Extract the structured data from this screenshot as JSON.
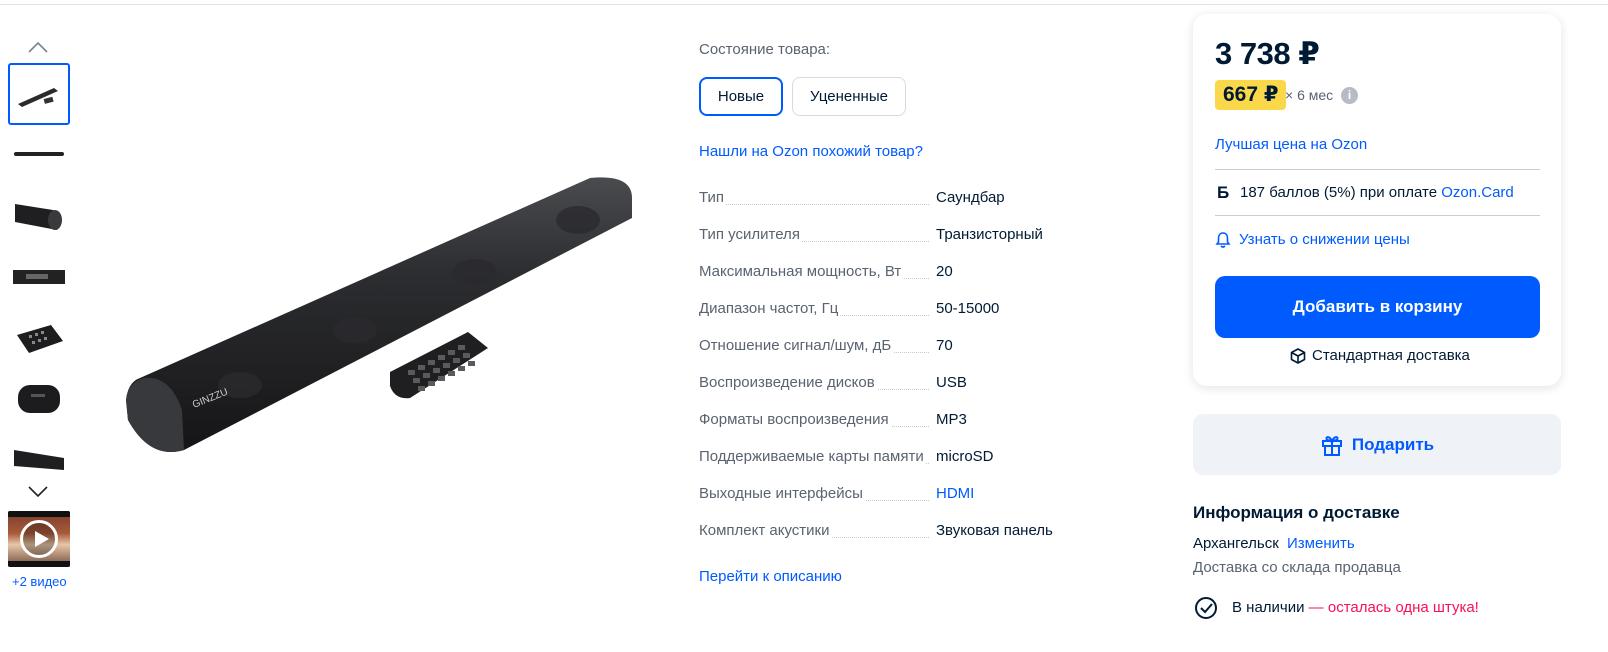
{
  "gallery": {
    "thumbnails": [
      "soundbar-with-remote",
      "soundbar-side",
      "soundbar-end",
      "soundbar-panel",
      "remote-control",
      "soundbar-end-cap",
      "soundbar-angle"
    ],
    "video_label": "+2 видео"
  },
  "condition": {
    "label": "Состояние товара:",
    "options": [
      "Новые",
      "Уцененные"
    ],
    "selected": "Новые"
  },
  "similar_link": "Нашли на Ozon похожий товар?",
  "specs": [
    {
      "name": "Тип",
      "value": "Саундбар"
    },
    {
      "name": "Тип усилителя",
      "value": "Транзисторный"
    },
    {
      "name": "Максимальная мощность, Вт",
      "value": "20"
    },
    {
      "name": "Диапазон частот, Гц",
      "value": "50-15000"
    },
    {
      "name": "Отношение сигнал/шум, дБ",
      "value": "70"
    },
    {
      "name": "Воспроизведение дисков",
      "value": "USB"
    },
    {
      "name": "Форматы воспроизведения",
      "value": "MP3"
    },
    {
      "name": "Поддерживаемые карты памяти",
      "value": "microSD"
    },
    {
      "name": "Выходные интерфейсы",
      "value": "HDMI"
    },
    {
      "name": "Комплект акустики",
      "value": "Звуковая панель"
    }
  ],
  "description_link": "Перейти к описанию",
  "price_card": {
    "price": "3 738 ₽",
    "installment": "667 ₽",
    "months": "× 6 мес",
    "best_price": "Лучшая цена на Ozon",
    "bonus_letter": "Б",
    "bonus_text": "187 баллов (5%) при оплате ",
    "bonus_link": "Ozon.Card",
    "price_alert": "Узнать о снижении цены",
    "add_to_cart": "Добавить в корзину",
    "delivery_type": "Стандартная доставка"
  },
  "gift_button": "Подарить",
  "delivery": {
    "title": "Информация о доставке",
    "city": "Архангельск",
    "change": "Изменить",
    "source": "Доставка со склада продавца",
    "stock": "В наличии",
    "stock_warning": " — осталась одна штука!"
  },
  "colors": {
    "accent": "#005bff",
    "installment_bg": "#fbd84a",
    "warning": "#f91155"
  }
}
